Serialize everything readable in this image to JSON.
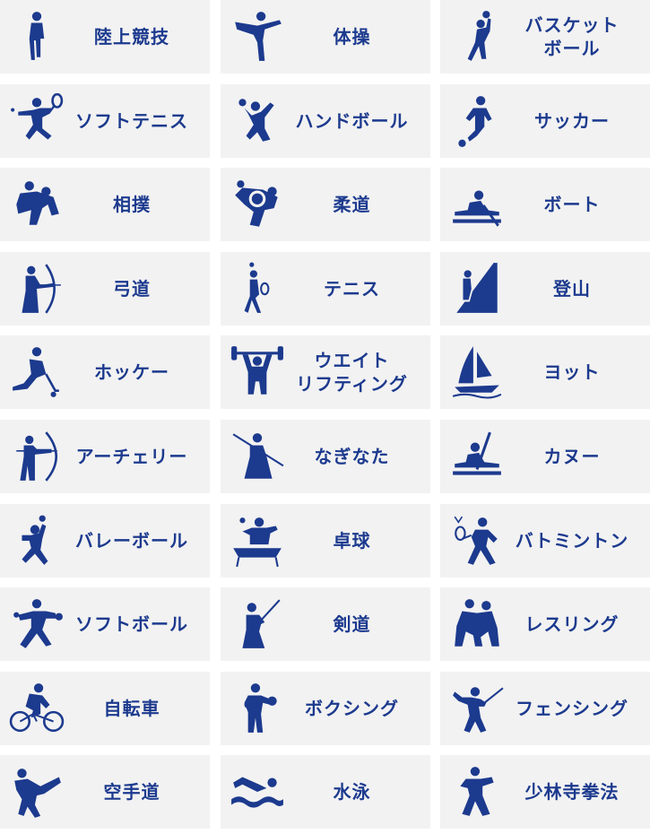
{
  "sports": [
    {
      "label": "陸上競技",
      "icon": "athletics-icon"
    },
    {
      "label": "体操",
      "icon": "gymnastics-icon"
    },
    {
      "label": "バスケット\nボール",
      "icon": "basketball-icon"
    },
    {
      "label": "ソフトテニス",
      "icon": "soft-tennis-icon"
    },
    {
      "label": "ハンドボール",
      "icon": "handball-icon"
    },
    {
      "label": "サッカー",
      "icon": "soccer-icon"
    },
    {
      "label": "相撲",
      "icon": "sumo-icon"
    },
    {
      "label": "柔道",
      "icon": "judo-icon"
    },
    {
      "label": "ボート",
      "icon": "rowing-icon"
    },
    {
      "label": "弓道",
      "icon": "kyudo-icon"
    },
    {
      "label": "テニス",
      "icon": "tennis-icon"
    },
    {
      "label": "登山",
      "icon": "mountaineering-icon"
    },
    {
      "label": "ホッケー",
      "icon": "hockey-icon"
    },
    {
      "label": "ウエイト\nリフティング",
      "icon": "weightlifting-icon"
    },
    {
      "label": "ヨット",
      "icon": "sailing-icon"
    },
    {
      "label": "アーチェリー",
      "icon": "archery-icon"
    },
    {
      "label": "なぎなた",
      "icon": "naginata-icon"
    },
    {
      "label": "カヌー",
      "icon": "canoe-icon"
    },
    {
      "label": "バレーボール",
      "icon": "volleyball-icon"
    },
    {
      "label": "卓球",
      "icon": "table-tennis-icon"
    },
    {
      "label": "バトミントン",
      "icon": "badminton-icon"
    },
    {
      "label": "ソフトボール",
      "icon": "softball-icon"
    },
    {
      "label": "剣道",
      "icon": "kendo-icon"
    },
    {
      "label": "レスリング",
      "icon": "wrestling-icon"
    },
    {
      "label": "自転車",
      "icon": "cycling-icon"
    },
    {
      "label": "ボクシング",
      "icon": "boxing-icon"
    },
    {
      "label": "フェンシング",
      "icon": "fencing-icon"
    },
    {
      "label": "空手道",
      "icon": "karate-icon"
    },
    {
      "label": "水泳",
      "icon": "swimming-icon"
    },
    {
      "label": "少林寺拳法",
      "icon": "shorinji-kempo-icon"
    }
  ],
  "colors": {
    "tile_bg": "#f2f2f2",
    "accent": "#1c3a8e"
  }
}
